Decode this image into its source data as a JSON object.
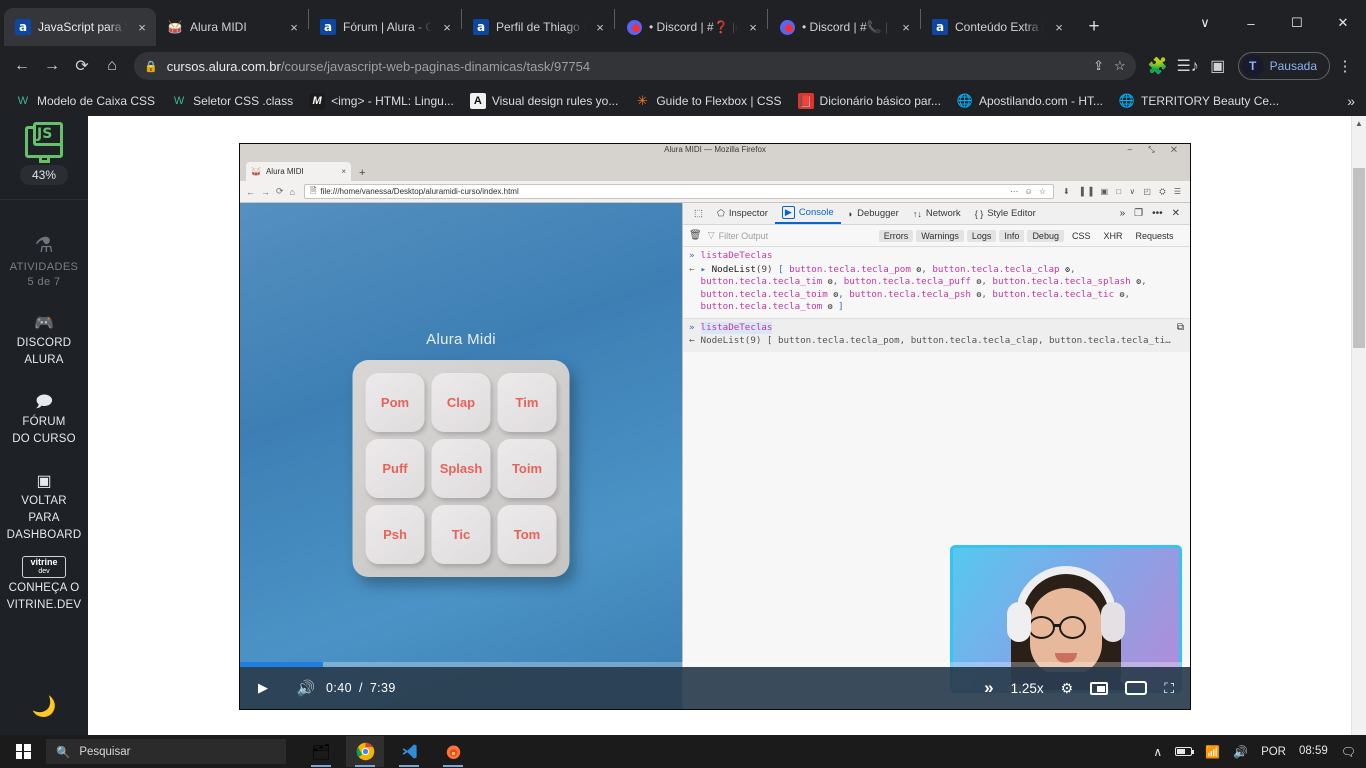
{
  "browser": {
    "tabs": [
      {
        "title": "JavaScript para W",
        "favicon": "alura-icon",
        "active": true,
        "close": "×"
      },
      {
        "title": "Alura MIDI",
        "favicon": "drum-icon",
        "active": false,
        "close": "×"
      },
      {
        "title": "Fórum | Alura - C",
        "favicon": "alura-icon",
        "active": false,
        "close": "×"
      },
      {
        "title": "Perfil de Thiago F",
        "favicon": "alura-icon",
        "active": false,
        "close": "×"
      },
      {
        "title": "• Discord | #❓ |d",
        "favicon": "discord-icon",
        "active": false,
        "close": "×"
      },
      {
        "title": "• Discord | #📞 |",
        "favicon": "discord-icon",
        "active": false,
        "close": "×"
      },
      {
        "title": "Conteúdo Extra |",
        "favicon": "alura-icon",
        "active": false,
        "close": "×"
      }
    ],
    "new_tab_label": "+",
    "window_controls": {
      "tab_search": "∨",
      "minimize": "–",
      "maximize": "☐",
      "close": "✕"
    },
    "nav": {
      "back": "←",
      "forward": "→",
      "reload": "⟳",
      "home": "⌂"
    },
    "omnibox": {
      "lock": "🔒",
      "url_domain": "cursos.alura.com.br",
      "url_path": "/course/javascript-web-paginas-dinamicas/task/97754",
      "share_icon": "share-icon",
      "star_icon": "☆"
    },
    "toolbar": {
      "extensions": "🧩",
      "media": "media-icon",
      "sidepanel": "▣",
      "profile_name": "Pausada",
      "profile_initial": "T",
      "menu": "⋮"
    },
    "bookmarks": [
      {
        "label": "Modelo de Caixa CSS",
        "icon": "W",
        "icon_color": "#3cb59a"
      },
      {
        "label": "Seletor CSS .class",
        "icon": "W",
        "icon_color": "#3cb59a"
      },
      {
        "label": "<img> - HTML: Lingu...",
        "icon": "M",
        "icon_color": "#ffffff"
      },
      {
        "label": "Visual design rules yo...",
        "icon": "A",
        "icon_color": "#ffffff"
      },
      {
        "label": "Guide to Flexbox | CSS",
        "icon": "✳",
        "icon_color": "#ff7a18"
      },
      {
        "label": "Dicionário básico par...",
        "icon": "📕",
        "icon_color": "#e8312a"
      },
      {
        "label": "Apostilando.com - HT...",
        "icon": "🌐",
        "icon_color": "#cfd2d6"
      },
      {
        "label": "TERRITORY Beauty Ce...",
        "icon": "🌐",
        "icon_color": "#cfd2d6"
      }
    ],
    "bookmarks_overflow": "»"
  },
  "sidebar": {
    "course_icon": "js-course-icon",
    "progress_percent": "43%",
    "activities_icon": "flask-icon",
    "activities_label": "ATIVIDADES",
    "activities_count": "5 de 7",
    "items": [
      {
        "icon": "discord-icon",
        "line1": "DISCORD",
        "line2": "ALURA"
      },
      {
        "icon": "forum-icon",
        "line1": "FÓRUM",
        "line2": "DO CURSO"
      },
      {
        "icon": "dashboard-icon",
        "line1": "VOLTAR",
        "line2": "PARA",
        "line3": "DASHBOARD"
      }
    ],
    "vitrine": {
      "badge_top": "vitrine",
      "badge_bottom": "dev",
      "line1": "CONHEÇA O",
      "line2": "VITRINE.DEV"
    },
    "darkmode_icon": "🌙"
  },
  "video": {
    "inner_window": {
      "title": "Alura MIDI — Mozilla Firefox",
      "window_controls": "–  ⤡  ✕",
      "tab_label": "Alura MIDI",
      "tab_close": "×",
      "newtab": "+",
      "nav_back": "←",
      "nav_fwd": "→",
      "nav_reload": "⟳",
      "nav_home": "⌂",
      "url": "file:///home/vanessa/Desktop/aluramidi-curso/index.html",
      "url_page_icon": "🗎",
      "url_right_icons": "⋯ ☺ ☆",
      "toolbar_icons": "⬇ ▐▐ ▣ □ ∨ ◰ ⛭ ☰"
    },
    "app": {
      "title": "Alura Midi",
      "keys": [
        "Pom",
        "Clap",
        "Tim",
        "Puff",
        "Splash",
        "Toim",
        "Psh",
        "Tic",
        "Tom"
      ]
    },
    "devtools": {
      "tabs": [
        {
          "label": "Inspector",
          "icon": "⬠",
          "active": false
        },
        {
          "label": "Console",
          "icon": "▶",
          "active": true
        },
        {
          "label": "Debugger",
          "icon": "◗",
          "active": false
        },
        {
          "label": "Network",
          "icon": "↑↓",
          "active": false
        },
        {
          "label": "Style Editor",
          "icon": "{ }",
          "active": false
        }
      ],
      "picker_icon": "⬚",
      "overflow": "»",
      "dock_icon": "❐",
      "more_icon": "•••",
      "close_icon": "✕",
      "trash_icon": "🗑",
      "filter_icon": "▽",
      "filter_placeholder": "Filter Output",
      "filters": [
        "Errors",
        "Warnings",
        "Logs",
        "Info",
        "Debug"
      ],
      "filters_plain": [
        "CSS",
        "XHR",
        "Requests"
      ],
      "settings_icon": "⚙",
      "entries": [
        {
          "prompt": "»",
          "input": "listaDeTeclas",
          "arrow": "←",
          "expander": "▸",
          "type": "NodeList",
          "count": "(9)",
          "open_bracket": "[",
          "nodes": [
            "button.tecla.tecla_pom",
            "button.tecla.tecla_clap",
            "button.tecla.tecla_tim",
            "button.tecla.tecla_puff",
            "button.tecla.tecla_splash",
            "button.tecla.tecla_toim",
            "button.tecla.tecla_psh",
            "button.tecla.tecla_tic",
            "button.tecla.tecla_tom"
          ],
          "close_bracket": "]"
        },
        {
          "prompt": "»",
          "input": "listaDeTeclas",
          "arrow": "←",
          "collapsed_text": "NodeList(9) [ button.tecla.tecla_pom, button.tecla.tecla_clap, button.tecla.tecla_ti…",
          "copy_icon": "⧉"
        }
      ]
    },
    "controls": {
      "play_icon": "▶",
      "volume_icon": "🔊",
      "current_time": "0:40",
      "separator": "/",
      "total_time": "7:39",
      "forward_icon": "»",
      "speed": "1.25x",
      "settings_icon": "⚙",
      "pip_icon": "pip-icon",
      "theater_icon": "theater-icon",
      "fullscreen_icon": "⛶",
      "progress_percent": 8.7
    }
  },
  "taskbar": {
    "start_icon": "windows-logo",
    "search_icon": "🔍",
    "search_placeholder": "Pesquisar",
    "apps": [
      {
        "name": "file-explorer-icon",
        "glyph": "🗂",
        "active": false
      },
      {
        "name": "chrome-icon",
        "glyph": "chrome",
        "active": true
      },
      {
        "name": "vscode-icon",
        "glyph": "vscode",
        "active": false
      },
      {
        "name": "firefox-icon",
        "glyph": "firefox",
        "active": false
      }
    ],
    "tray": {
      "chevron": "∧",
      "battery": "battery-icon",
      "wifi": "📶",
      "volume": "🔊",
      "language": "POR",
      "clock": "08:59",
      "notifications": "🗨"
    }
  }
}
